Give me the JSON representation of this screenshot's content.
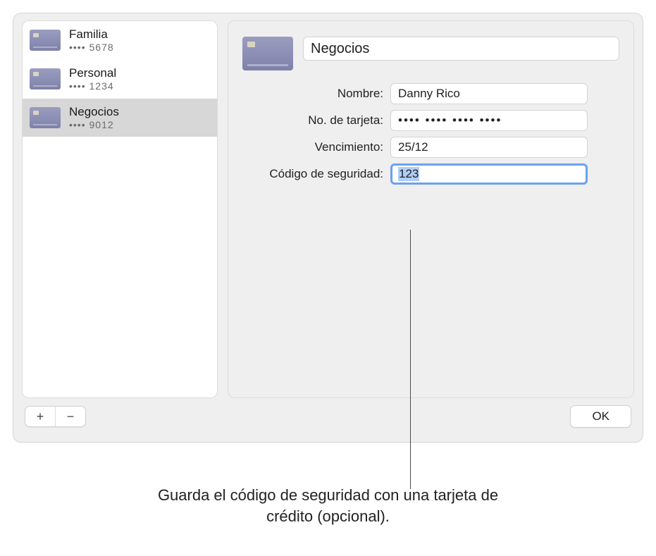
{
  "sidebar": {
    "items": [
      {
        "name": "Familia",
        "masked": "•••• 5678",
        "selected": false
      },
      {
        "name": "Personal",
        "masked": "•••• 1234",
        "selected": false
      },
      {
        "name": "Negocios",
        "masked": "•••• 9012",
        "selected": true
      }
    ]
  },
  "detail": {
    "title": "Negocios",
    "fields": {
      "name": {
        "label": "Nombre:",
        "value": "Danny Rico"
      },
      "card_number": {
        "label": "No. de tarjeta:",
        "value": "•••• •••• •••• ••••"
      },
      "expiry": {
        "label": "Vencimiento:",
        "value": "25/12"
      },
      "sec_code": {
        "label": "Código de seguridad:",
        "value": "123"
      }
    }
  },
  "buttons": {
    "add": "+",
    "remove": "−",
    "ok": "OK"
  },
  "caption": "Guarda el código de seguridad con una tarjeta de crédito (opcional)."
}
